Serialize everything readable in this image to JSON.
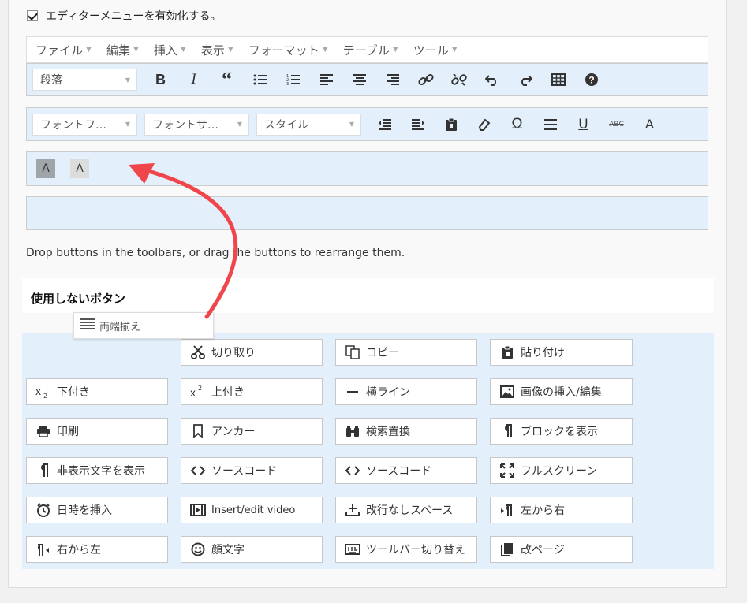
{
  "settings": {
    "enable_label": "エディターメニューを有効化する。"
  },
  "menubar": [
    {
      "label": "ファイル"
    },
    {
      "label": "編集"
    },
    {
      "label": "挿入"
    },
    {
      "label": "表示"
    },
    {
      "label": "フォーマット"
    },
    {
      "label": "テーブル"
    },
    {
      "label": "ツール"
    }
  ],
  "toolbar1": {
    "format_select": "段落",
    "buttons": [
      "bold-icon",
      "italic-icon",
      "blockquote-icon",
      "bullet-list-icon",
      "numbered-list-icon",
      "align-left-icon",
      "align-center-icon",
      "align-right-icon",
      "link-icon",
      "unlink-icon",
      "undo-icon",
      "redo-icon",
      "table-icon",
      "help-icon"
    ]
  },
  "toolbar2": {
    "font_family": "フォントフ…",
    "font_size": "フォントサ…",
    "style": "スタイル",
    "buttons": [
      "outdent-icon",
      "indent-icon",
      "paste-icon",
      "eraser-icon",
      "omega-icon",
      "hr-icon",
      "underline-icon",
      "strikethrough-icon",
      "text-color-icon"
    ],
    "strike_text": "ABC",
    "text_color_text": "A"
  },
  "toolbar3": {
    "buttons": [
      {
        "text": "A",
        "name": "background-color-button"
      },
      {
        "text": "A",
        "name": "text-color-button"
      }
    ]
  },
  "help_text": "Drop buttons in the toolbars, or drag the buttons to rearrange them.",
  "unused": {
    "title": "使用しないボタン",
    "dragging": {
      "label": "両端揃え",
      "icon": "justify-icon"
    },
    "rows": [
      [
        null,
        {
          "label": "切り取り",
          "icon": "scissors-icon"
        },
        {
          "label": "コピー",
          "icon": "copy-icon"
        },
        {
          "label": "貼り付け",
          "icon": "paste-icon"
        }
      ],
      [
        {
          "label": "下付き",
          "icon": "subscript-icon"
        },
        {
          "label": "上付き",
          "icon": "superscript-icon"
        },
        {
          "label": "横ライン",
          "icon": "horizontal-line-icon"
        },
        {
          "label": "画像の挿入/編集",
          "icon": "image-icon"
        }
      ],
      [
        {
          "label": "印刷",
          "icon": "print-icon"
        },
        {
          "label": "アンカー",
          "icon": "bookmark-icon"
        },
        {
          "label": "検索置換",
          "icon": "binoculars-icon"
        },
        {
          "label": "ブロックを表示",
          "icon": "pilcrow-icon"
        }
      ],
      [
        {
          "label": "非表示文字を表示",
          "icon": "pilcrow-icon"
        },
        {
          "label": "ソースコード",
          "icon": "code-icon"
        },
        {
          "label": "ソースコード",
          "icon": "code-icon"
        },
        {
          "label": "フルスクリーン",
          "icon": "fullscreen-icon"
        }
      ],
      [
        {
          "label": "日時を挿入",
          "icon": "clock-icon"
        },
        {
          "label": "Insert/edit video",
          "icon": "video-icon"
        },
        {
          "label": "改行なしスペース",
          "icon": "nbsp-icon"
        },
        {
          "label": "左から右",
          "icon": "ltr-icon"
        }
      ],
      [
        {
          "label": "右から左",
          "icon": "rtl-icon"
        },
        {
          "label": "顔文字",
          "icon": "smiley-icon"
        },
        {
          "label": "ツールバー切り替え",
          "icon": "keyboard-icon"
        },
        {
          "label": "改ページ",
          "icon": "page-break-icon"
        }
      ]
    ]
  },
  "colors": {
    "toolbar_bg": "#e3f0fc",
    "annotation_arrow": "#f0454b"
  }
}
